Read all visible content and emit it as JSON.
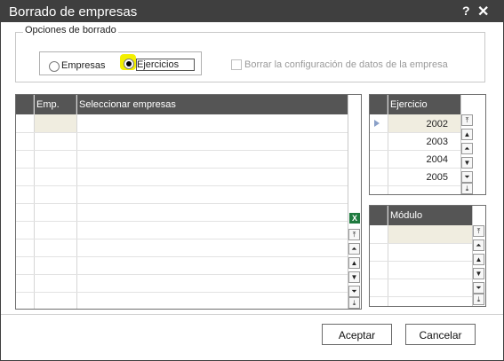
{
  "window": {
    "title": "Borrado de empresas",
    "help_glyph": "?",
    "close_glyph": "✕"
  },
  "options": {
    "legend": "Opciones de borrado",
    "radios": [
      {
        "label": "Empresas",
        "selected": false
      },
      {
        "label": "Ejercicios",
        "selected": true
      }
    ],
    "checkbox": {
      "label": "Borrar la configuración de datos de la  empresa",
      "checked": false,
      "enabled": false
    }
  },
  "companies_grid": {
    "columns": [
      "Emp.",
      "Seleccionar empresas"
    ],
    "excel_glyph": "X"
  },
  "years_grid": {
    "column": "Ejercicio",
    "rows": [
      "2002",
      "2003",
      "2004",
      "2005"
    ]
  },
  "modules_grid": {
    "column": "Módulo"
  },
  "buttons": {
    "accept": "Aceptar",
    "cancel": "Cancelar"
  },
  "colors": {
    "titlebar": "#3f3f3f",
    "header": "#555555",
    "highlight": "#f3ef00"
  },
  "icons": [
    "help-icon",
    "close-icon",
    "excel-icon",
    "scroll-first-icon",
    "scroll-pageup-icon",
    "scroll-up-icon",
    "scroll-down-icon",
    "scroll-pagedown-icon",
    "scroll-last-icon"
  ]
}
